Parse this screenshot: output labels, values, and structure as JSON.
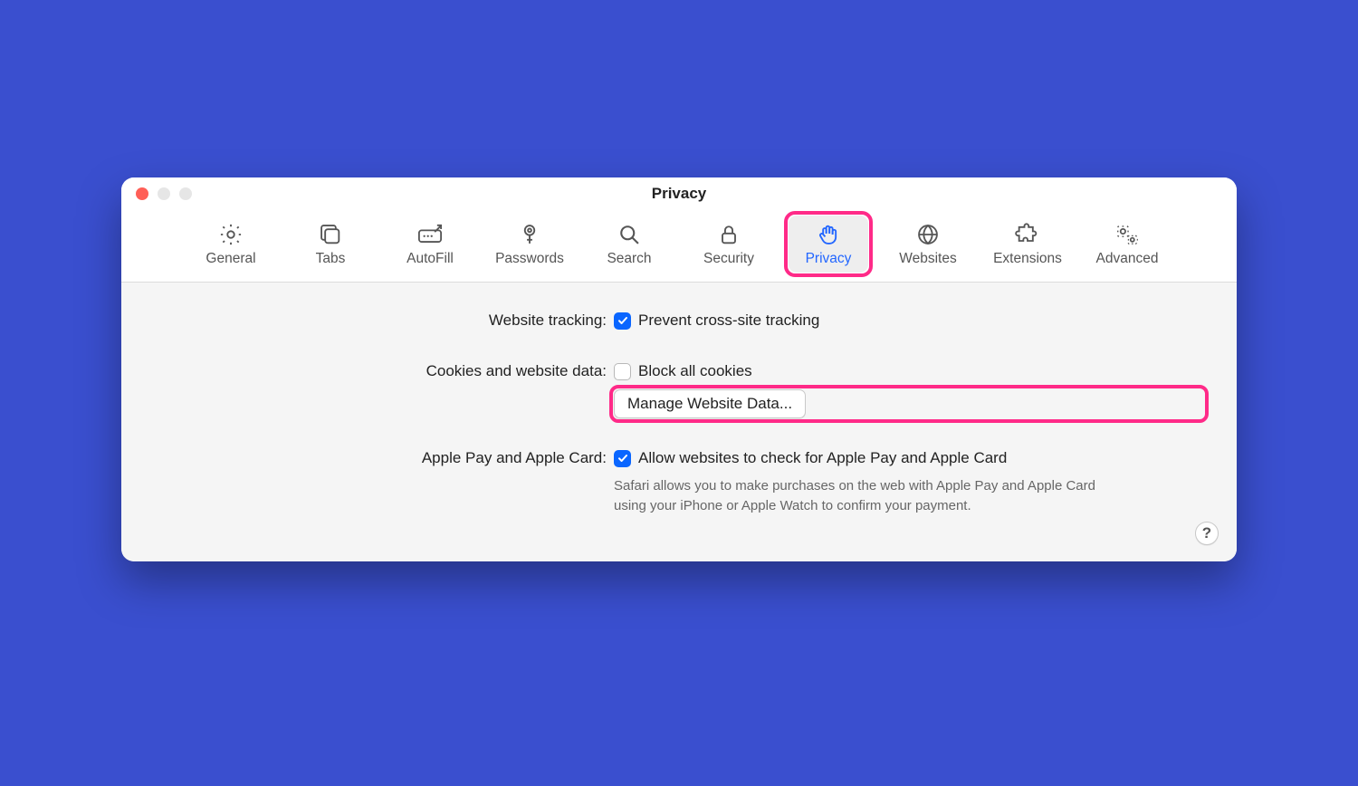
{
  "window": {
    "title": "Privacy"
  },
  "toolbar": {
    "items": [
      {
        "label": "General"
      },
      {
        "label": "Tabs"
      },
      {
        "label": "AutoFill"
      },
      {
        "label": "Passwords"
      },
      {
        "label": "Search"
      },
      {
        "label": "Security"
      },
      {
        "label": "Privacy"
      },
      {
        "label": "Websites"
      },
      {
        "label": "Extensions"
      },
      {
        "label": "Advanced"
      }
    ],
    "selected_index": 6,
    "highlighted_index": 6
  },
  "sections": {
    "website_tracking": {
      "label": "Website tracking:",
      "options": [
        {
          "label": "Prevent cross-site tracking",
          "checked": true
        }
      ]
    },
    "cookies": {
      "label": "Cookies and website data:",
      "options": [
        {
          "label": "Block all cookies",
          "checked": false
        }
      ],
      "button_label": "Manage Website Data...",
      "button_highlighted": true
    },
    "apple_pay": {
      "label": "Apple Pay and Apple Card:",
      "options": [
        {
          "label": "Allow websites to check for Apple Pay and Apple Card",
          "checked": true
        }
      ],
      "description": "Safari allows you to make purchases on the web with Apple Pay and Apple Card using your iPhone or Apple Watch to confirm your payment."
    }
  },
  "help_button": "?"
}
